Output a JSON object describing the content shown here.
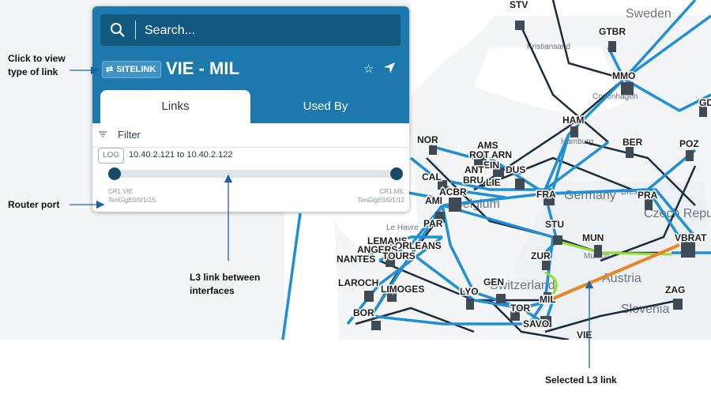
{
  "search": {
    "placeholder": "Search..."
  },
  "link": {
    "type_label": "SITELINK",
    "title": "VIE - MIL",
    "log_badge": "LOG",
    "ip_range": "10.40.2.121 to 10.40.2.122",
    "endpoint_a": {
      "router": "CR1.VIE",
      "interface": "TenGigE0/0/1/15"
    },
    "endpoint_b": {
      "router": "CR1.MIL",
      "interface": "TenGigE0/0/1/12"
    }
  },
  "tabs": {
    "links": "Links",
    "used_by": "Used By",
    "active": "Links"
  },
  "filter": {
    "label": "Filter"
  },
  "annotations": {
    "type_of_link": "Click to view type of link",
    "router_port": "Router port",
    "l3_link": "L3 link between interfaces",
    "selected_link": "Selected L3 link"
  },
  "map": {
    "regions": [
      "Sweden",
      "Germany",
      "Czech Republic",
      "Austria",
      "Slovenia",
      "Belgium",
      "Switzerland"
    ],
    "cities": [
      "Kristiansand",
      "Copenhagen",
      "Hamburg",
      "Dresden",
      "Munich",
      "Le Havre"
    ],
    "nodes": [
      "STV",
      "GTBR",
      "MMO",
      "GD",
      "HAM",
      "BER",
      "POZ",
      "NOR",
      "AMS",
      "ROT",
      "ARN",
      "EIN",
      "ANT",
      "DUS",
      "BRU",
      "LIE",
      "CAL",
      "ACBR",
      "AMI",
      "FRA",
      "PRA",
      "STU",
      "PAR",
      "MUN",
      "VBRAT",
      "LEMANS",
      "ORLEANS",
      "ANGERS",
      "TOURS",
      "NANTES",
      "ZUR",
      "LAROCH",
      "LIMOGES",
      "GEN",
      "LYO",
      "MIL",
      "ZAG",
      "TOR",
      "BOR",
      "SAVO",
      "VIE"
    ],
    "colors": {
      "link": "#1f8fd6",
      "backbone": "#1c2a3a",
      "selected_link": "#e8842a",
      "alt_path": "#8fe02a"
    }
  },
  "colors": {
    "panel_header": "#1c78ad",
    "search_bg": "#12597f",
    "port": "#184a63"
  }
}
